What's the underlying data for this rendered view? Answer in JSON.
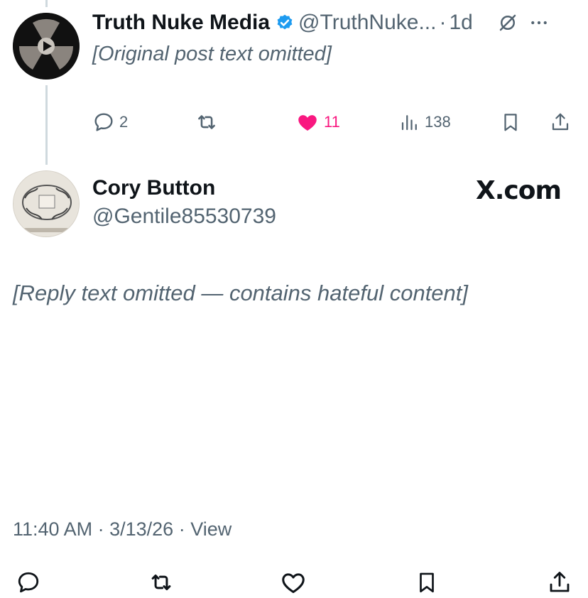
{
  "parent_tweet": {
    "name": "Truth Nuke Media",
    "handle": "@TruthNuke...",
    "separator": "·",
    "age": "1d",
    "text": "[Original post text omitted]",
    "emoji": "",
    "icons": {
      "verified": "verified-badge-icon",
      "grok": "grok-icon",
      "more": "more-icon"
    },
    "actions": {
      "replies": "2",
      "reposts": "",
      "likes": "11",
      "views": "138"
    },
    "colors": {
      "like": "#f91880",
      "verified": "#1d9bf0",
      "muted": "#536471"
    }
  },
  "reply": {
    "name": "Cory Button",
    "handle": "@Gentile85530739",
    "brand": "X.com",
    "text": "[Reply text omitted — contains hateful content]",
    "time": "11:40 AM",
    "date": "3/13/26",
    "view_label": "View",
    "separator": "·"
  }
}
